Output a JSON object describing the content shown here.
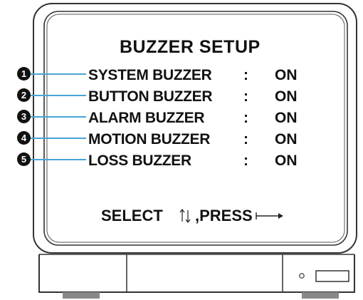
{
  "menu": {
    "title": "BUZZER SETUP",
    "separator": ":",
    "items": [
      {
        "marker": "1",
        "label": "SYSTEM BUZZER",
        "value": "ON"
      },
      {
        "marker": "2",
        "label": "BUTTON BUZZER",
        "value": "ON"
      },
      {
        "marker": "3",
        "label": "ALARM BUZZER",
        "value": "ON"
      },
      {
        "marker": "4",
        "label": "MOTION BUZZER",
        "value": "ON"
      },
      {
        "marker": "5",
        "label": "LOSS BUZZER",
        "value": "ON"
      }
    ],
    "footer": {
      "select_text": "SELECT",
      "select_icon": "up-down-arrows-icon",
      "press_text": ",PRESS",
      "press_icon": "enter-arrow-icon"
    }
  },
  "colors": {
    "leader_line": "#4aa3d6",
    "text": "#111111",
    "outline": "#333333"
  },
  "icons": {
    "power_indicator": "power-led-icon",
    "front_slot": "front-slot-icon"
  }
}
